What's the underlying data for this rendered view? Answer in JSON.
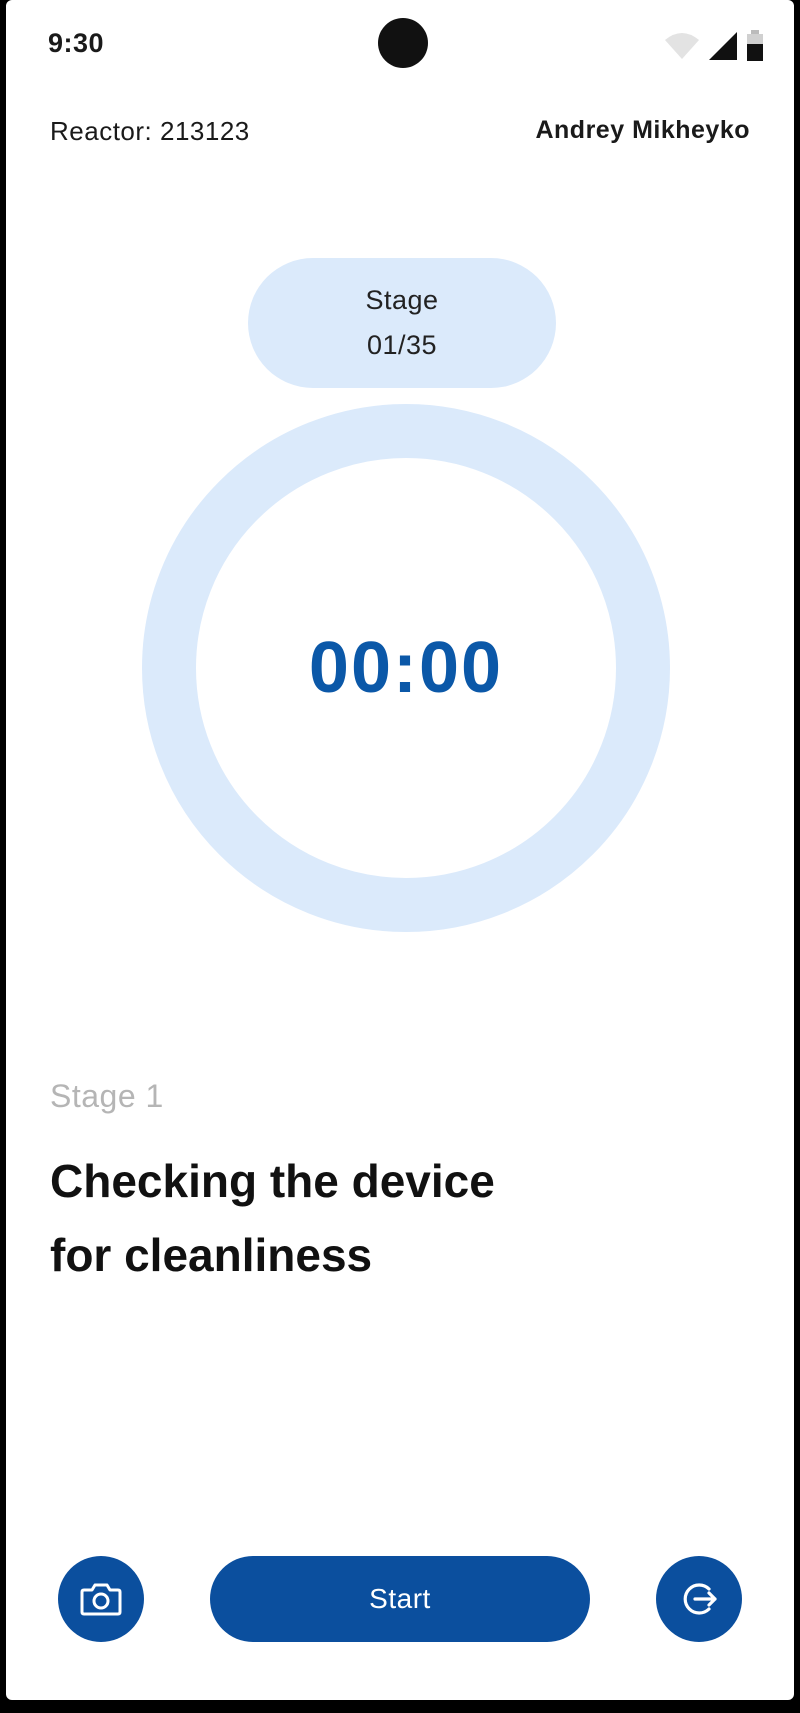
{
  "status_bar": {
    "time": "9:30",
    "icons": [
      "wifi-icon",
      "signal-icon",
      "battery-icon"
    ]
  },
  "header": {
    "reactor": "Reactor: 213123",
    "user": "Andrey Mikheyko"
  },
  "stage_pill": {
    "label": "Stage",
    "counter": "01/35"
  },
  "timer": {
    "value": "00:00",
    "progress": 0
  },
  "stage": {
    "caption": "Stage 1",
    "title_line1": "Checking the device",
    "title_line2": "for cleanliness"
  },
  "actions": {
    "camera_icon": "camera-icon",
    "start_label": "Start",
    "exit_icon": "exit-icon"
  },
  "colors": {
    "accent": "#0b4f9e",
    "timer_text": "#0b58a8",
    "ring": "#dbeafb",
    "caption": "#b5b5b5"
  }
}
